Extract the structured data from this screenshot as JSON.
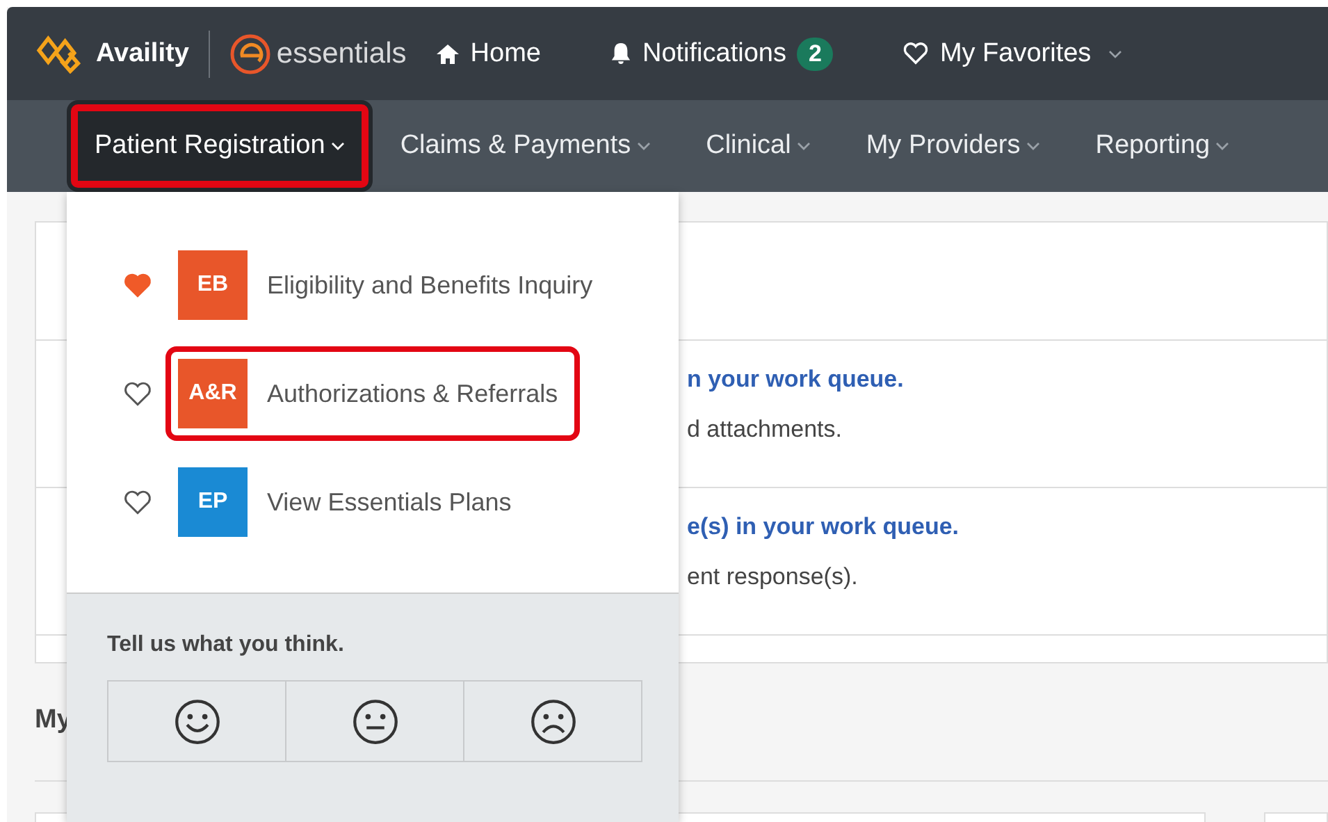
{
  "header": {
    "brand": "Availity",
    "product": "essentials",
    "links": [
      {
        "kind": "home",
        "label": "Home"
      },
      {
        "kind": "notifications",
        "label": "Notifications",
        "count": "2"
      },
      {
        "kind": "favorites",
        "label": "My Favorites"
      }
    ]
  },
  "nav": [
    {
      "label": "Patient Registration",
      "selected": true,
      "highlighted": true
    },
    {
      "label": "Claims & Payments",
      "selected": false,
      "highlighted": false
    },
    {
      "label": "Clinical",
      "selected": false,
      "highlighted": false
    },
    {
      "label": "My Providers",
      "selected": false,
      "highlighted": false
    },
    {
      "label": "Reporting",
      "selected": false,
      "highlighted": false
    }
  ],
  "menu": {
    "items": [
      {
        "badge": "EB",
        "color": "#e8562a",
        "label": "Eligibility and Benefits Inquiry",
        "favorite": true,
        "highlighted": false
      },
      {
        "badge": "A&R",
        "color": "#e8562a",
        "label": "Authorizations & Referrals",
        "favorite": false,
        "highlighted": true
      },
      {
        "badge": "EP",
        "color": "#1a8ad4",
        "label": "View Essentials Plans",
        "favorite": false,
        "highlighted": false
      }
    ],
    "feedback": {
      "prompt": "Tell us what you think.",
      "options": [
        {
          "kind": "happy"
        },
        {
          "kind": "neutral"
        },
        {
          "kind": "sad"
        }
      ]
    }
  },
  "queue": [
    {
      "title": "n your work queue.",
      "detail": "d attachments."
    },
    {
      "title": "e(s) in your work queue.",
      "detail": "ent response(s)."
    }
  ],
  "section_heading": "My"
}
